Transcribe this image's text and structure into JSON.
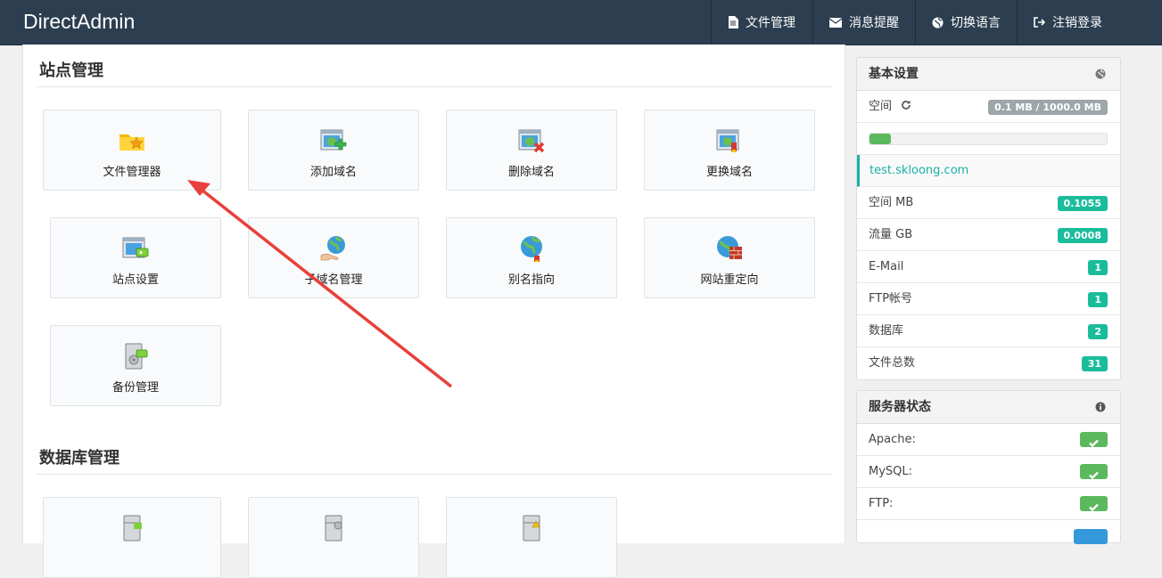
{
  "app": {
    "brand": "DirectAdmin",
    "nav": [
      {
        "label": "文件管理",
        "icon": "file-icon"
      },
      {
        "label": "消息提醒",
        "icon": "envelope-icon"
      },
      {
        "label": "切换语言",
        "icon": "globe-icon"
      },
      {
        "label": "注销登录",
        "icon": "logout-icon"
      }
    ]
  },
  "site_section": {
    "title": "站点管理",
    "items": [
      {
        "label": "文件管理器",
        "icon": "folder-star-icon"
      },
      {
        "label": "添加域名",
        "icon": "add-domain-icon"
      },
      {
        "label": "删除域名",
        "icon": "delete-domain-icon"
      },
      {
        "label": "更换域名",
        "icon": "change-domain-icon"
      },
      {
        "label": "站点设置",
        "icon": "site-settings-icon"
      },
      {
        "label": "子域名管理",
        "icon": "subdomain-icon"
      },
      {
        "label": "别名指向",
        "icon": "alias-icon"
      },
      {
        "label": "网站重定向",
        "icon": "redirect-icon"
      },
      {
        "label": "备份管理",
        "icon": "backup-icon"
      }
    ]
  },
  "db_section": {
    "title": "数据库管理"
  },
  "basic_panel": {
    "title": "基本设置",
    "space_label": "空间",
    "space_usage": "0.1 MB / 1000.0 MB",
    "usage_fraction": 0.0001,
    "domain": "test.skloong.com",
    "stats": [
      {
        "label": "空间 MB",
        "value": "0.1055"
      },
      {
        "label": "流量 GB",
        "value": "0.0008"
      },
      {
        "label": "E-Mail",
        "value": "1"
      },
      {
        "label": "FTP帐号",
        "value": "1"
      },
      {
        "label": "数据库",
        "value": "2"
      },
      {
        "label": "文件总数",
        "value": "31"
      }
    ]
  },
  "server_panel": {
    "title": "服务器状态",
    "services": [
      {
        "label": "Apache:",
        "status": "ok"
      },
      {
        "label": "MySQL:",
        "status": "ok"
      },
      {
        "label": "FTP:",
        "status": "ok"
      }
    ]
  },
  "colors": {
    "navbar": "#2c3e50",
    "badge": "#1abc9c",
    "ok": "#5cb85c",
    "arrow": "#e8403a"
  }
}
